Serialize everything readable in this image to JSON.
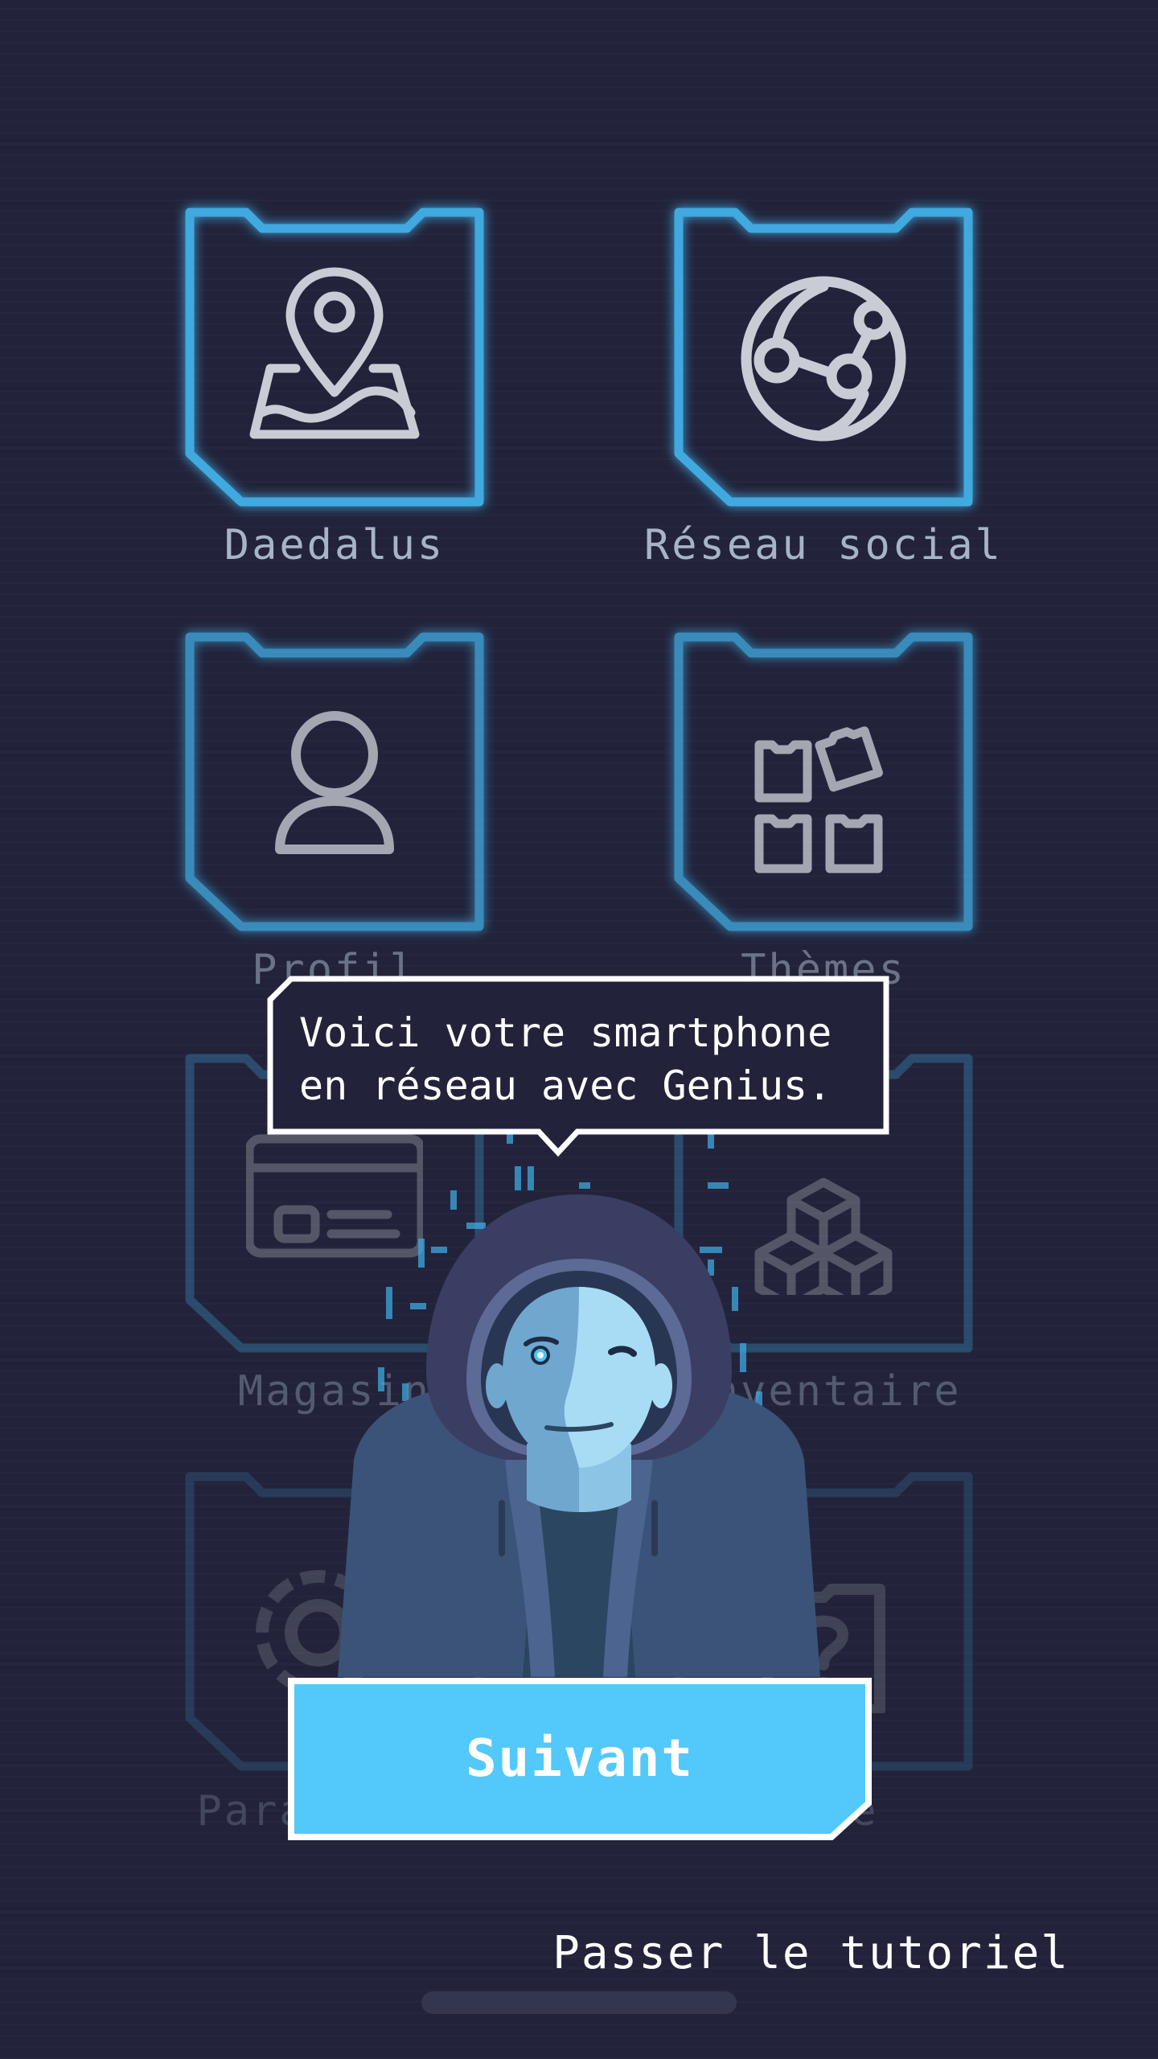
{
  "tiles": [
    {
      "label": "Daedalus",
      "icon": "map-pin-icon"
    },
    {
      "label": "Réseau social",
      "icon": "globe-network-icon"
    },
    {
      "label": "Profil",
      "icon": "person-icon"
    },
    {
      "label": "Thèmes",
      "icon": "themes-grid-icon"
    },
    {
      "label": "Magasin",
      "icon": "card-icon"
    },
    {
      "label": "Inventaire",
      "icon": "boxes-icon"
    },
    {
      "label": "Paramètres",
      "icon": "gear-icon"
    },
    {
      "label": "Aide",
      "icon": "help-icon"
    }
  ],
  "tutorial": {
    "message": "Voici votre smartphone\nen réseau avec Genius.",
    "next_label": "Suivant",
    "skip_label": "Passer le tutoriel"
  },
  "colors": {
    "background": "#22233a",
    "accent": "#4fc3f7",
    "frame_blue": "#3fa9e0",
    "icon_gray": "#c9ccd4"
  }
}
